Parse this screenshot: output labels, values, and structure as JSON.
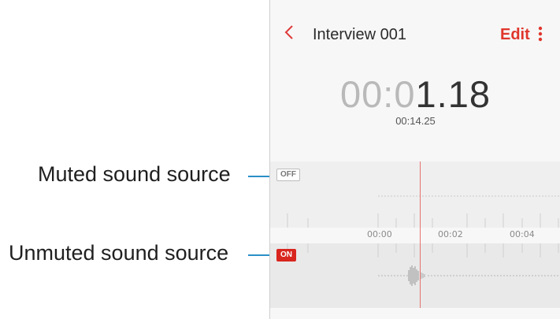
{
  "callouts": {
    "muted": "Muted sound source",
    "unmuted": "Unmuted sound source"
  },
  "header": {
    "back_icon": "chevron-left-icon",
    "title": "Interview 001",
    "edit_label": "Edit",
    "more_icon": "more-vertical-icon"
  },
  "timer": {
    "elapsed_dim": "00:0",
    "elapsed_bright": "1.18",
    "total": "00:14.25"
  },
  "tracks": {
    "muted_badge": "OFF",
    "unmuted_badge": "ON"
  },
  "timeline": {
    "ticks": [
      "00:00",
      "00:02",
      "00:04"
    ]
  },
  "colors": {
    "accent": "#e0362c",
    "callout_line": "#2b8fc7",
    "on_badge": "#d8261f"
  }
}
